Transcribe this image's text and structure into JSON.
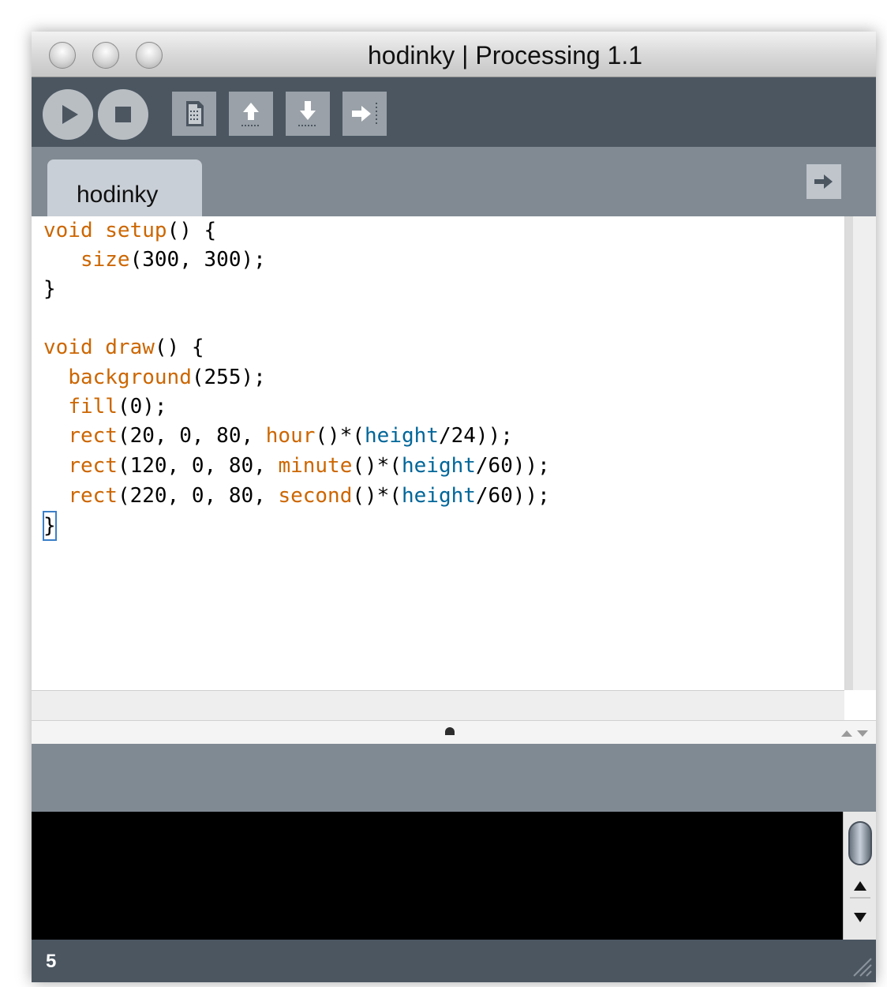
{
  "window": {
    "title": "hodinky | Processing 1.1"
  },
  "toolbar": {
    "buttons": [
      {
        "name": "run",
        "icon": "play-icon"
      },
      {
        "name": "stop",
        "icon": "stop-icon"
      },
      {
        "name": "new",
        "icon": "new-document-icon"
      },
      {
        "name": "open",
        "icon": "upload-arrow-icon"
      },
      {
        "name": "save",
        "icon": "download-arrow-icon"
      },
      {
        "name": "export",
        "icon": "export-arrow-icon"
      }
    ]
  },
  "tabs": [
    {
      "label": "hodinky",
      "active": true
    }
  ],
  "editor": {
    "lines": [
      "void setup() {",
      "   size(300, 300);",
      "}",
      "",
      "void draw() {",
      "  background(255);",
      "  fill(0);",
      "  rect(20, 0, 80, hour()*(height/24));",
      "  rect(120, 0, 80, minute()*(height/60));",
      "  rect(220, 0, 80, second()*(height/60));",
      "}"
    ]
  },
  "status": {
    "line_number": "5"
  },
  "colors": {
    "toolbar": "#4b5661",
    "tabbar": "#818a93",
    "keyword": "#cc6600",
    "variable": "#006699",
    "console": "#000000"
  }
}
